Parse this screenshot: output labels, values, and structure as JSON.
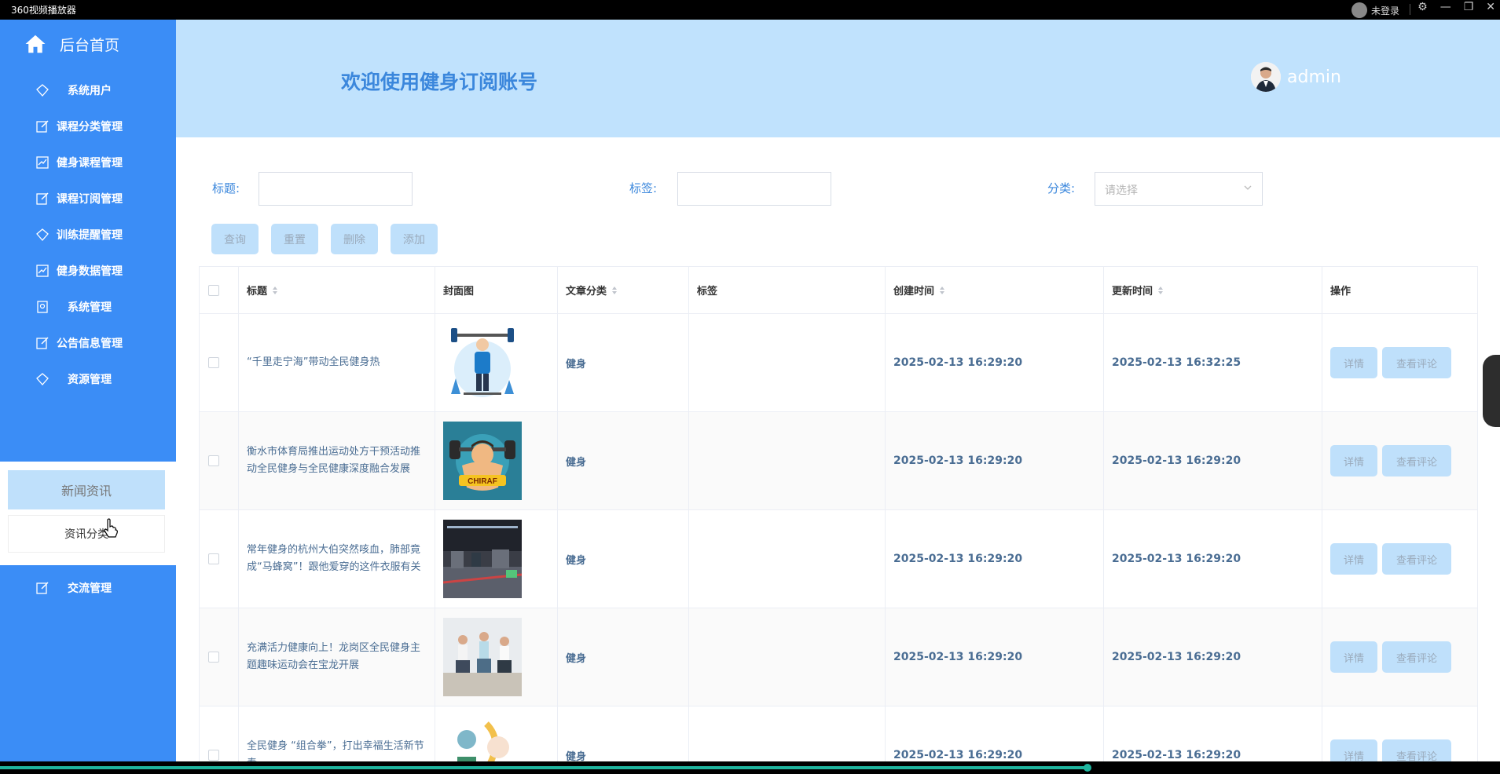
{
  "titlebar": {
    "app_title": "360视频播放器",
    "login": "未登录",
    "controls": [
      "⚙",
      "—",
      "❐",
      "✕"
    ]
  },
  "sidebar": {
    "home": "后台首页",
    "items": [
      {
        "label": "系统用户",
        "icon": "diamond-icon"
      },
      {
        "label": "课程分类管理",
        "icon": "edit-icon"
      },
      {
        "label": "健身课程管理",
        "icon": "chart-icon"
      },
      {
        "label": "课程订阅管理",
        "icon": "edit-icon"
      },
      {
        "label": "训练提醒管理",
        "icon": "diamond-icon"
      },
      {
        "label": "健身数据管理",
        "icon": "chart-icon"
      },
      {
        "label": "系统管理",
        "icon": "badge-icon"
      },
      {
        "label": "公告信息管理",
        "icon": "edit-icon"
      },
      {
        "label": "资源管理",
        "icon": "diamond-icon"
      }
    ],
    "submenu": {
      "active": "新闻资讯",
      "item": "资讯分类"
    },
    "after": {
      "label": "交流管理",
      "icon": "edit-icon"
    }
  },
  "header": {
    "welcome": "欢迎使用健身订阅账号",
    "username": "admin"
  },
  "filters": {
    "title_label": "标题:",
    "tag_label": "标签:",
    "category_label": "分类:",
    "category_placeholder": "请选择"
  },
  "toolbar": {
    "query": "查询",
    "reset": "重置",
    "delete": "删除",
    "add": "添加"
  },
  "table": {
    "columns": [
      "标题",
      "封面图",
      "文章分类",
      "标签",
      "创建时间",
      "更新时间",
      "操作"
    ],
    "rows": [
      {
        "title": "“千里走宁海”带动全民健身热",
        "category": "健身",
        "tag": "",
        "created": "2025-02-13 16:29:20",
        "updated": "2025-02-13 16:32:25"
      },
      {
        "title": "衡水市体育局推出运动处方干预活动推动全民健身与全民健康深度融合发展",
        "category": "健身",
        "tag": "",
        "created": "2025-02-13 16:29:20",
        "updated": "2025-02-13 16:29:20"
      },
      {
        "title": "常年健身的杭州大伯突然咳血，肺部竟成“马蜂窝”！跟他爱穿的这件衣服有关",
        "category": "健身",
        "tag": "",
        "created": "2025-02-13 16:29:20",
        "updated": "2025-02-13 16:29:20"
      },
      {
        "title": "充满活力健康向上！龙岗区全民健身主题趣味运动会在宝龙开展",
        "category": "健身",
        "tag": "",
        "created": "2025-02-13 16:29:20",
        "updated": "2025-02-13 16:29:20"
      },
      {
        "title": "全民健身 “组合拳”，打出幸福生活新节奏",
        "category": "健身",
        "tag": "",
        "created": "2025-02-13 16:29:20",
        "updated": "2025-02-13 16:29:20"
      }
    ],
    "detail_label": "详情",
    "comments_label": "查看评论",
    "thumb_logo_text": "CHIRAF"
  },
  "player": {
    "progress": 0.725
  },
  "colors": {
    "sidebar": "#3b8df6",
    "header": "#c0e2fd",
    "accent": "#3b87dc",
    "button": "#bfe0fb"
  }
}
